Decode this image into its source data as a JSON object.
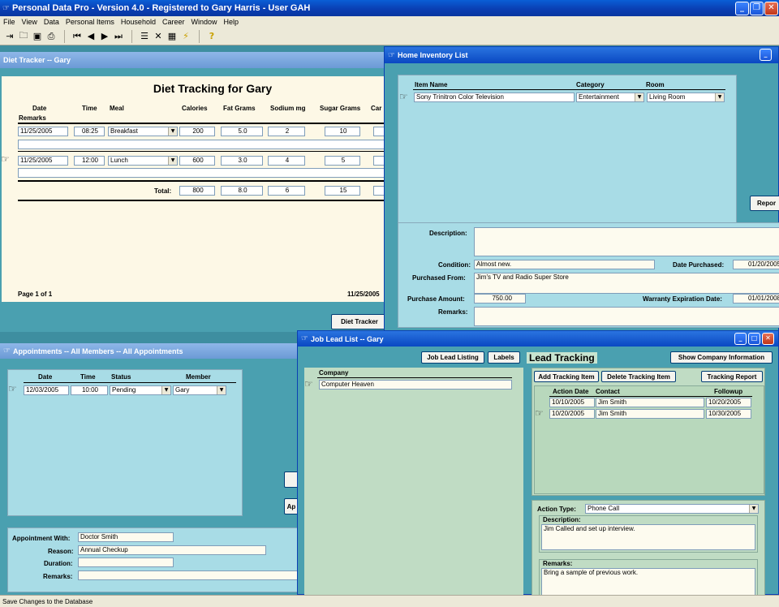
{
  "app": {
    "title": "Personal Data Pro - Version 4.0 - Registered to Gary Harris - User GAH",
    "menu": [
      "File",
      "View",
      "Data",
      "Personal Items",
      "Household",
      "Career",
      "Window",
      "Help"
    ]
  },
  "toolbar": {
    "icons": [
      "exit-icon",
      "open-icon",
      "save-icon",
      "print-icon",
      "first-record-icon",
      "prev-record-icon",
      "next-record-icon",
      "last-record-icon",
      "list-icon",
      "delete-icon",
      "calculator-icon",
      "quick-icon",
      "help-icon"
    ]
  },
  "diet": {
    "window_title": "Diet Tracker -- Gary",
    "heading": "Diet Tracking for Gary",
    "headers": {
      "date": "Date",
      "remarks": "Remarks",
      "time": "Time",
      "meal": "Meal",
      "calories": "Calories",
      "fat": "Fat Grams",
      "sodium": "Sodium mg",
      "sugar": "Sugar Grams",
      "carb": "Car"
    },
    "rows": [
      {
        "date": "11/25/2005",
        "time": "08:25",
        "meal": "Breakfast",
        "calories": "200",
        "fat": "5.0",
        "sodium": "2",
        "sugar": "10"
      },
      {
        "date": "11/25/2005",
        "time": "12:00",
        "meal": "Lunch",
        "calories": "600",
        "fat": "3.0",
        "sodium": "4",
        "sugar": "5"
      }
    ],
    "total_label": "Total:",
    "totals": {
      "calories": "800",
      "fat": "8.0",
      "sodium": "6",
      "sugar": "15"
    },
    "page": "Page 1 of 1",
    "footer_date": "11/25/2005",
    "button": "Diet Tracker"
  },
  "inventory": {
    "window_title": "Home Inventory List",
    "headers": {
      "item": "Item Name",
      "category": "Category",
      "room": "Room"
    },
    "row": {
      "item": "Sony Trinitron Color Television",
      "category": "Entertainment",
      "room": "Living Room"
    },
    "report_button": "Repor",
    "labels": {
      "description": "Description:",
      "condition": "Condition:",
      "date_purchased": "Date Purchased:",
      "purchased_from": "Purchased From:",
      "purchase_amount": "Purchase Amount:",
      "warranty": "Warranty Expiration Date:",
      "remarks": "Remarks:"
    },
    "values": {
      "description": "",
      "condition": "Almost new.",
      "date_purchased": "01/20/2005",
      "purchased_from": "Jim's TV and Radio Super Store",
      "purchase_amount": "750.00",
      "warranty": "01/01/2008",
      "remarks": ""
    }
  },
  "appointments": {
    "window_title": "Appointments -- All Members -- All Appointments",
    "headers": {
      "date": "Date",
      "time": "Time",
      "status": "Status",
      "member": "Member"
    },
    "row": {
      "date": "12/03/2005",
      "time": "10:00",
      "status": "Pending",
      "member": "Gary"
    },
    "side_buttons": [
      "",
      "Ap"
    ],
    "labels": {
      "with": "Appointment With:",
      "reason": "Reason:",
      "duration": "Duration:",
      "remarks": "Remarks:"
    },
    "values": {
      "with": "Doctor Smith",
      "reason": "Annual Checkup",
      "duration": "",
      "remarks": ""
    }
  },
  "joblead": {
    "window_title": "Job Lead List -- Gary",
    "buttons": {
      "listing": "Job Lead Listing",
      "labels": "Labels",
      "company_info": "Show Company Information",
      "add": "Add Tracking Item",
      "delete": "Delete Tracking Item",
      "report": "Tracking Report"
    },
    "company_header": "Company",
    "company": "Computer Heaven",
    "lead_title": "Lead Tracking",
    "track_headers": {
      "action_date": "Action Date",
      "contact": "Contact",
      "followup": "Followup"
    },
    "tracking": [
      {
        "action_date": "10/10/2005",
        "contact": "Jim Smith",
        "followup": "10/20/2005"
      },
      {
        "action_date": "10/20/2005",
        "contact": "Jim Smith",
        "followup": "10/30/2005"
      }
    ],
    "action_type_label": "Action Type:",
    "action_type": "Phone Call",
    "description_label": "Description:",
    "description": "Jim Called and set up interview.",
    "remarks_label": "Remarks:",
    "remarks": "Bring a sample of previous work."
  },
  "status": "Save Changes to the Database"
}
